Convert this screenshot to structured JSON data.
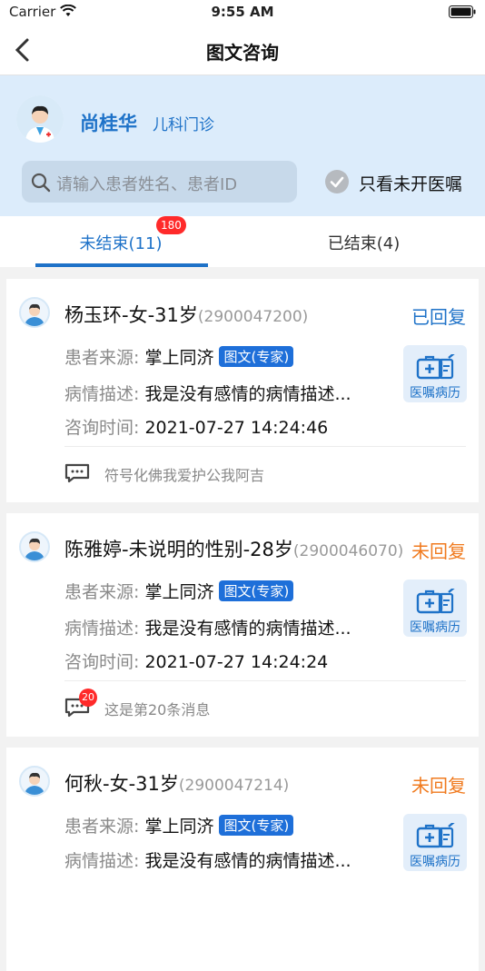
{
  "status_bar": {
    "carrier": "Carrier",
    "time": "9:55 AM"
  },
  "nav": {
    "title": "图文咨询"
  },
  "doctor": {
    "name": "尚桂华",
    "department": "儿科门诊"
  },
  "search": {
    "placeholder": "请输入患者姓名、患者ID"
  },
  "filter": {
    "label": "只看未开医嘱"
  },
  "tabs": [
    {
      "label": "未结束(11)",
      "badge": "180"
    },
    {
      "label": "已结束(4)"
    }
  ],
  "labels": {
    "source": "患者来源:",
    "description": "病情描述:",
    "time": "咨询时间:",
    "prescription": "医嘱病历"
  },
  "colors": {
    "accent": "#1e72c8",
    "replied": "#1e72c8",
    "not_replied": "#f07a1e",
    "badge": "#ff2a2a"
  },
  "consultations": [
    {
      "name": "杨玉环-女-31岁",
      "patient_id": "(2900047200)",
      "status": "已回复",
      "status_type": "replied",
      "source": "掌上同济",
      "tag": "图文(专家)",
      "description": "我是没有感情的病情描述...",
      "time": "2021-07-27 14:24:46",
      "last_message": "符号化佛我爱护公我阿吉",
      "unread": ""
    },
    {
      "name": "陈雅婷-未说明的性别-28岁",
      "patient_id": "(2900046070)",
      "status": "未回复",
      "status_type": "not_replied",
      "source": "掌上同济",
      "tag": "图文(专家)",
      "description": "我是没有感情的病情描述...",
      "time": "2021-07-27 14:24:24",
      "last_message": "这是第20条消息",
      "unread": "20"
    },
    {
      "name": "何秋-女-31岁",
      "patient_id": "(2900047214)",
      "status": "未回复",
      "status_type": "not_replied",
      "source": "掌上同济",
      "tag": "图文(专家)",
      "description": "我是没有感情的病情描述...",
      "time": "",
      "last_message": "",
      "unread": ""
    }
  ]
}
